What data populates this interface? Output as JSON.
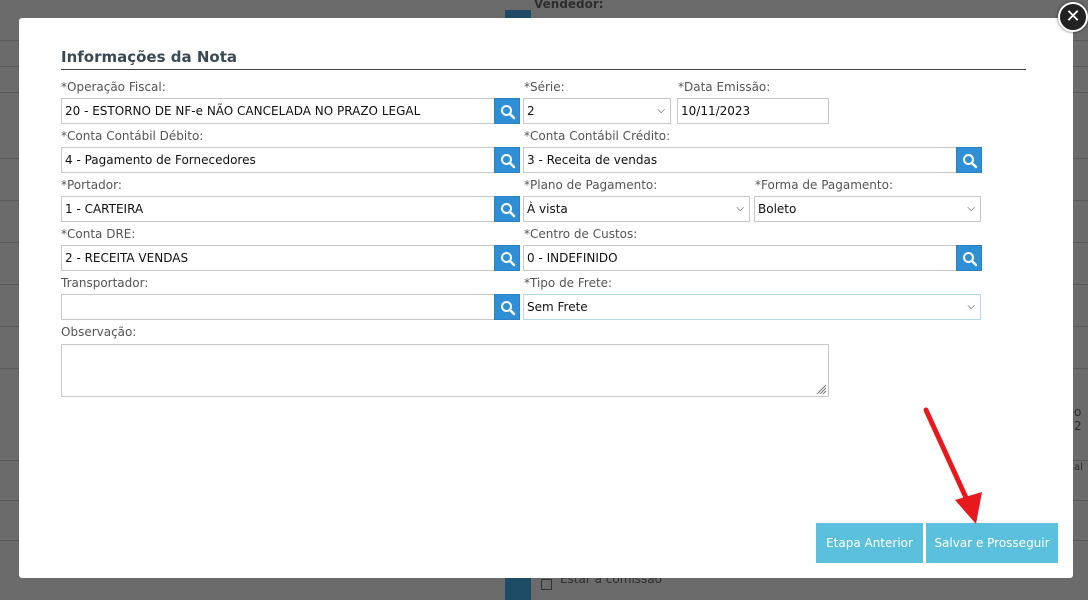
{
  "background": {
    "vendedor_label": "Vendedor:",
    "fragment_right_a": "o 2",
    "fragment_right_b": "al",
    "fragment_bottom": "Estar a comissão"
  },
  "modal": {
    "close_glyph": "✕",
    "title": "Informações da Nota",
    "fields": {
      "operacao_fiscal": {
        "label": "*Operação Fiscal:",
        "value": "20 - ESTORNO DE NF-e NÃO CANCELADA NO PRAZO LEGAL"
      },
      "serie": {
        "label": "*Série:",
        "value": "2"
      },
      "data_emissao": {
        "label": "*Data Emissão:",
        "value": "10/11/2023"
      },
      "conta_debito": {
        "label": "*Conta Contábil Débito:",
        "value": "4 - Pagamento de Fornecedores"
      },
      "conta_credito": {
        "label": "*Conta Contábil Crédito:",
        "value": "3 - Receita de vendas"
      },
      "portador": {
        "label": "*Portador:",
        "value": "1 - CARTEIRA"
      },
      "plano_pagamento": {
        "label": "*Plano de Pagamento:",
        "value": "À vista"
      },
      "forma_pagamento": {
        "label": "*Forma de Pagamento:",
        "value": "Boleto"
      },
      "conta_dre": {
        "label": "*Conta DRE:",
        "value": "2 - RECEITA VENDAS"
      },
      "centro_custos": {
        "label": "*Centro de Custos:",
        "value": "0 - INDEFINIDO"
      },
      "transportador": {
        "label": "Transportador:",
        "value": ""
      },
      "tipo_frete": {
        "label": "*Tipo de Frete:",
        "value": "Sem Frete"
      },
      "observacao": {
        "label": "Observação:",
        "value": ""
      }
    },
    "buttons": {
      "previous": "Etapa Anterior",
      "save_continue": "Salvar e Prosseguir"
    }
  },
  "icons": {
    "search": "search-icon",
    "dropdown": "chevron-down-icon",
    "close": "close-icon",
    "annotation_arrow": "arrow-icon"
  },
  "colors": {
    "accent_blue": "#2f8fd6",
    "button_light_blue": "#5bc0de",
    "annotation_red": "#e8191c"
  }
}
